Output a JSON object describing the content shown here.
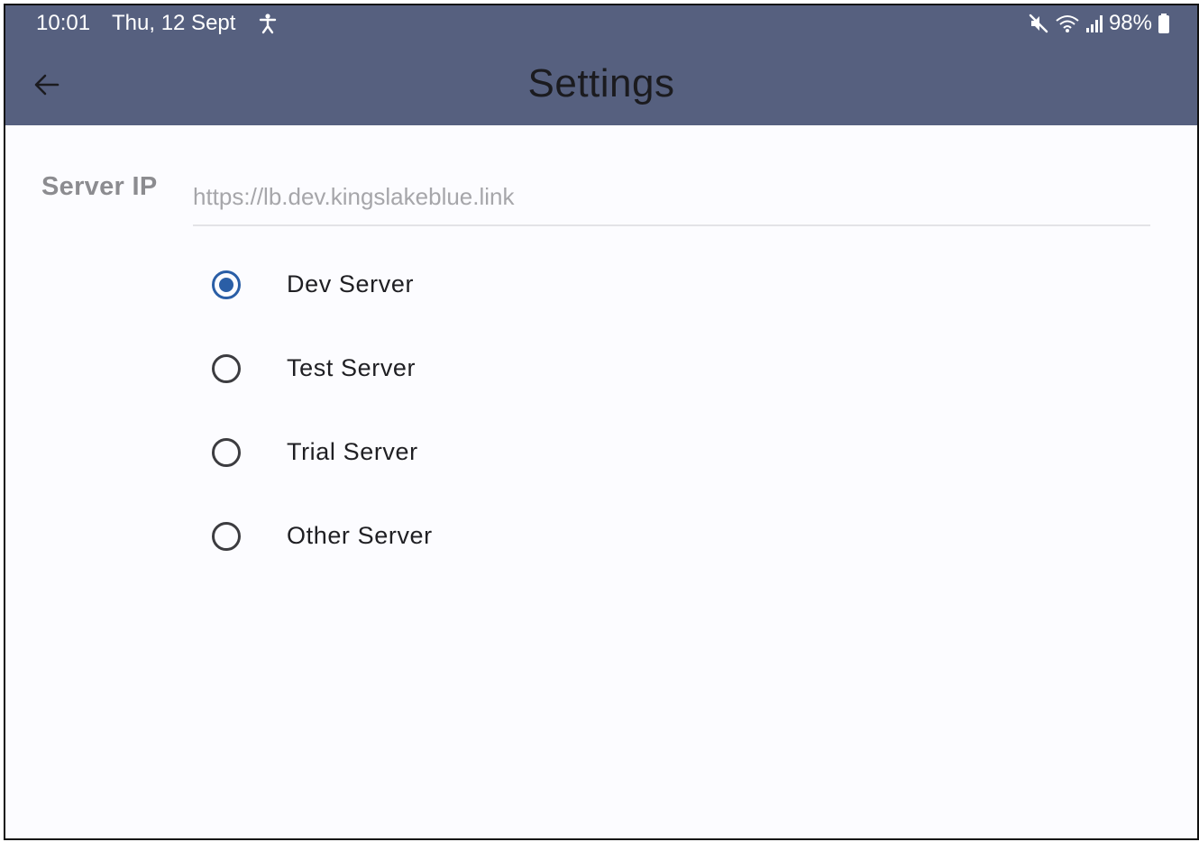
{
  "status_bar": {
    "time": "10:01",
    "date": "Thu, 12 Sept",
    "battery": "98%",
    "icons": [
      "accessibility-icon",
      "mute-icon",
      "wifi-icon",
      "signal-icon",
      "battery-icon"
    ]
  },
  "app_bar": {
    "title": "Settings",
    "back_icon": "arrow-back-icon",
    "background": "#56607f"
  },
  "server": {
    "label": "Server IP",
    "value": "",
    "placeholder": "https://lb.dev.kingslakeblue.link"
  },
  "options": [
    {
      "label": "Dev Server",
      "selected": true
    },
    {
      "label": "Test Server",
      "selected": false
    },
    {
      "label": "Trial Server",
      "selected": false
    },
    {
      "label": "Other Server",
      "selected": false
    }
  ],
  "colors": {
    "accent": "#2a5ea6",
    "app_bar": "#56607f",
    "background": "#fcfcff"
  }
}
